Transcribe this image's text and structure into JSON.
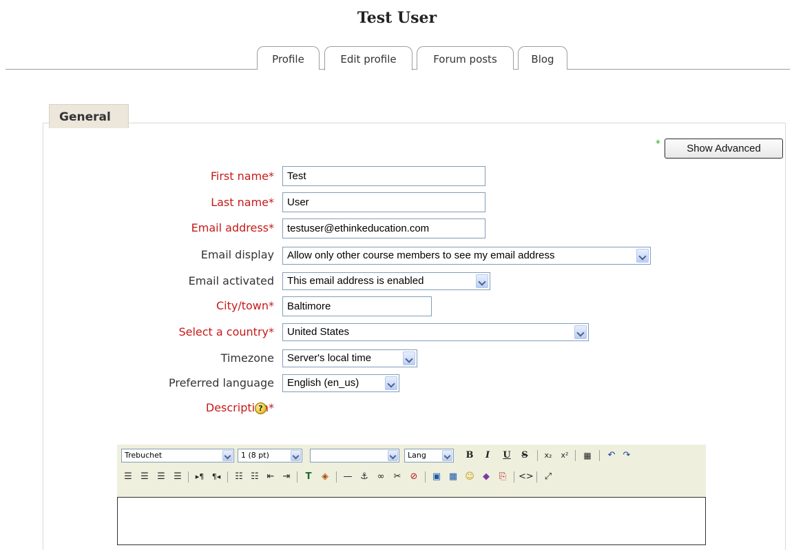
{
  "page_title": "Test User",
  "tabs": [
    {
      "label": "Profile"
    },
    {
      "label": "Edit profile"
    },
    {
      "label": "Forum posts"
    },
    {
      "label": "Blog"
    }
  ],
  "fieldset": {
    "legend": "General",
    "show_advanced_label": "Show Advanced",
    "required_mark": "*"
  },
  "fields": {
    "first_name": {
      "label": "First name",
      "value": "Test"
    },
    "last_name": {
      "label": "Last name",
      "value": "User"
    },
    "email": {
      "label": "Email address",
      "value": "testuser@ethinkeducation.com"
    },
    "email_display": {
      "label": "Email display",
      "value": "Allow only other course members to see my email address"
    },
    "email_activated": {
      "label": "Email activated",
      "value": "This email address is enabled"
    },
    "city": {
      "label": "City/town",
      "value": "Baltimore"
    },
    "country": {
      "label": "Select a country",
      "value": "United States"
    },
    "timezone": {
      "label": "Timezone",
      "value": "Server's local time"
    },
    "language": {
      "label": "Preferred language",
      "value": "English (en_us)"
    },
    "description": {
      "label": "Description",
      "help": "?"
    }
  },
  "editor": {
    "font_family": "Trebuchet",
    "font_size": "1 (8 pt)",
    "format": "",
    "lang": "Lang",
    "bold": "B",
    "italic": "I",
    "underline": "U",
    "strike": "S"
  },
  "colors": {
    "required_label": "#c61818",
    "toolbar_bg": "#efefde",
    "legend_bg": "#ece6db"
  }
}
